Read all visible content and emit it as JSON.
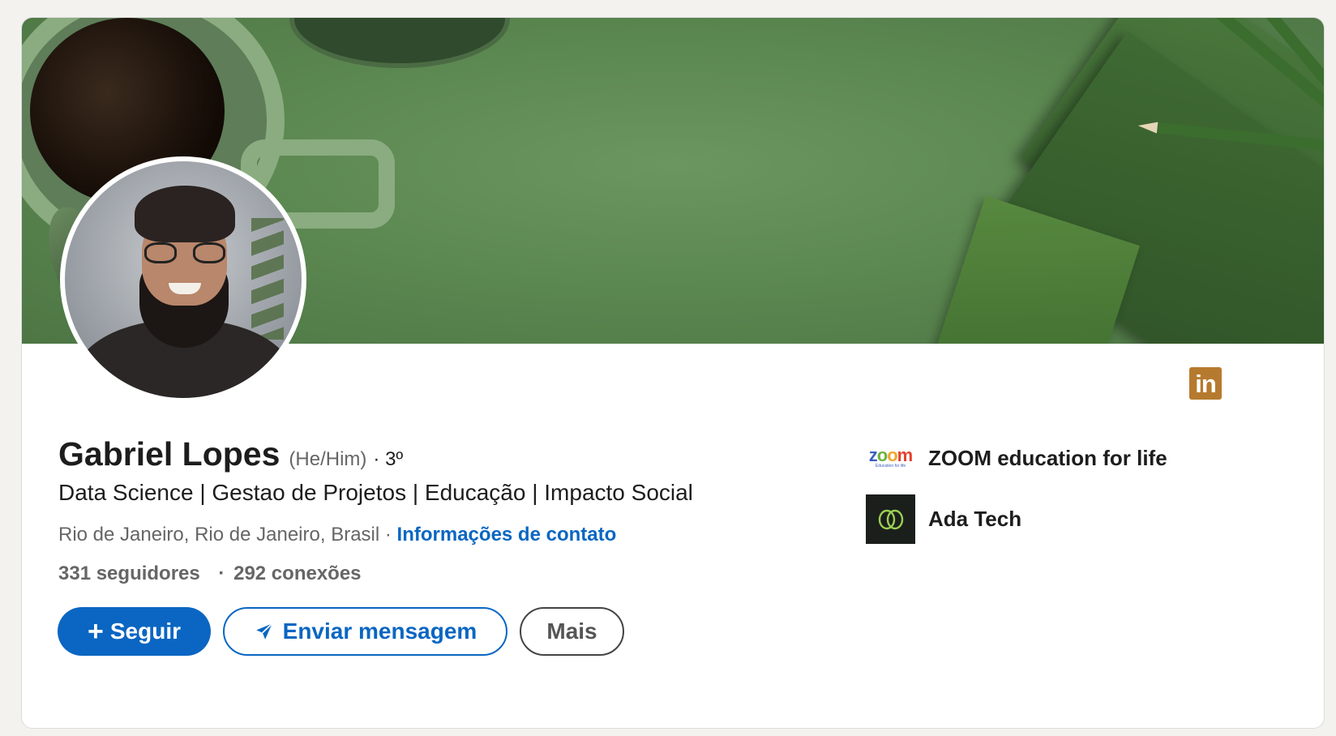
{
  "profile": {
    "name": "Gabriel Lopes",
    "pronouns": "(He/Him)",
    "degree": "· 3º",
    "headline": "Data Science | Gestao de Projetos | Educação | Impacto Social",
    "location": "Rio de Janeiro, Rio de Janeiro, Brasil",
    "location_separator": "·",
    "contact_link": "Informações de contato",
    "followers": "331 seguidores",
    "stats_separator": "·",
    "connections": "292 conexões"
  },
  "actions": {
    "follow_plus": "+",
    "follow_label": "Seguir",
    "message_label": "Enviar mensagem",
    "more_label": "Mais"
  },
  "badge": {
    "linkedin_text": "in",
    "color": "#b67a2e"
  },
  "companies": [
    {
      "name": "ZOOM education for life",
      "logo_word": "zoom",
      "logo_sub": "Education for life"
    },
    {
      "name": "Ada Tech",
      "logo_icon": "ada-leaf-icon"
    }
  ],
  "colors": {
    "primary": "#0a66c2",
    "banner": "#5c8851",
    "text": "#1d1d1d",
    "muted": "#666666"
  }
}
